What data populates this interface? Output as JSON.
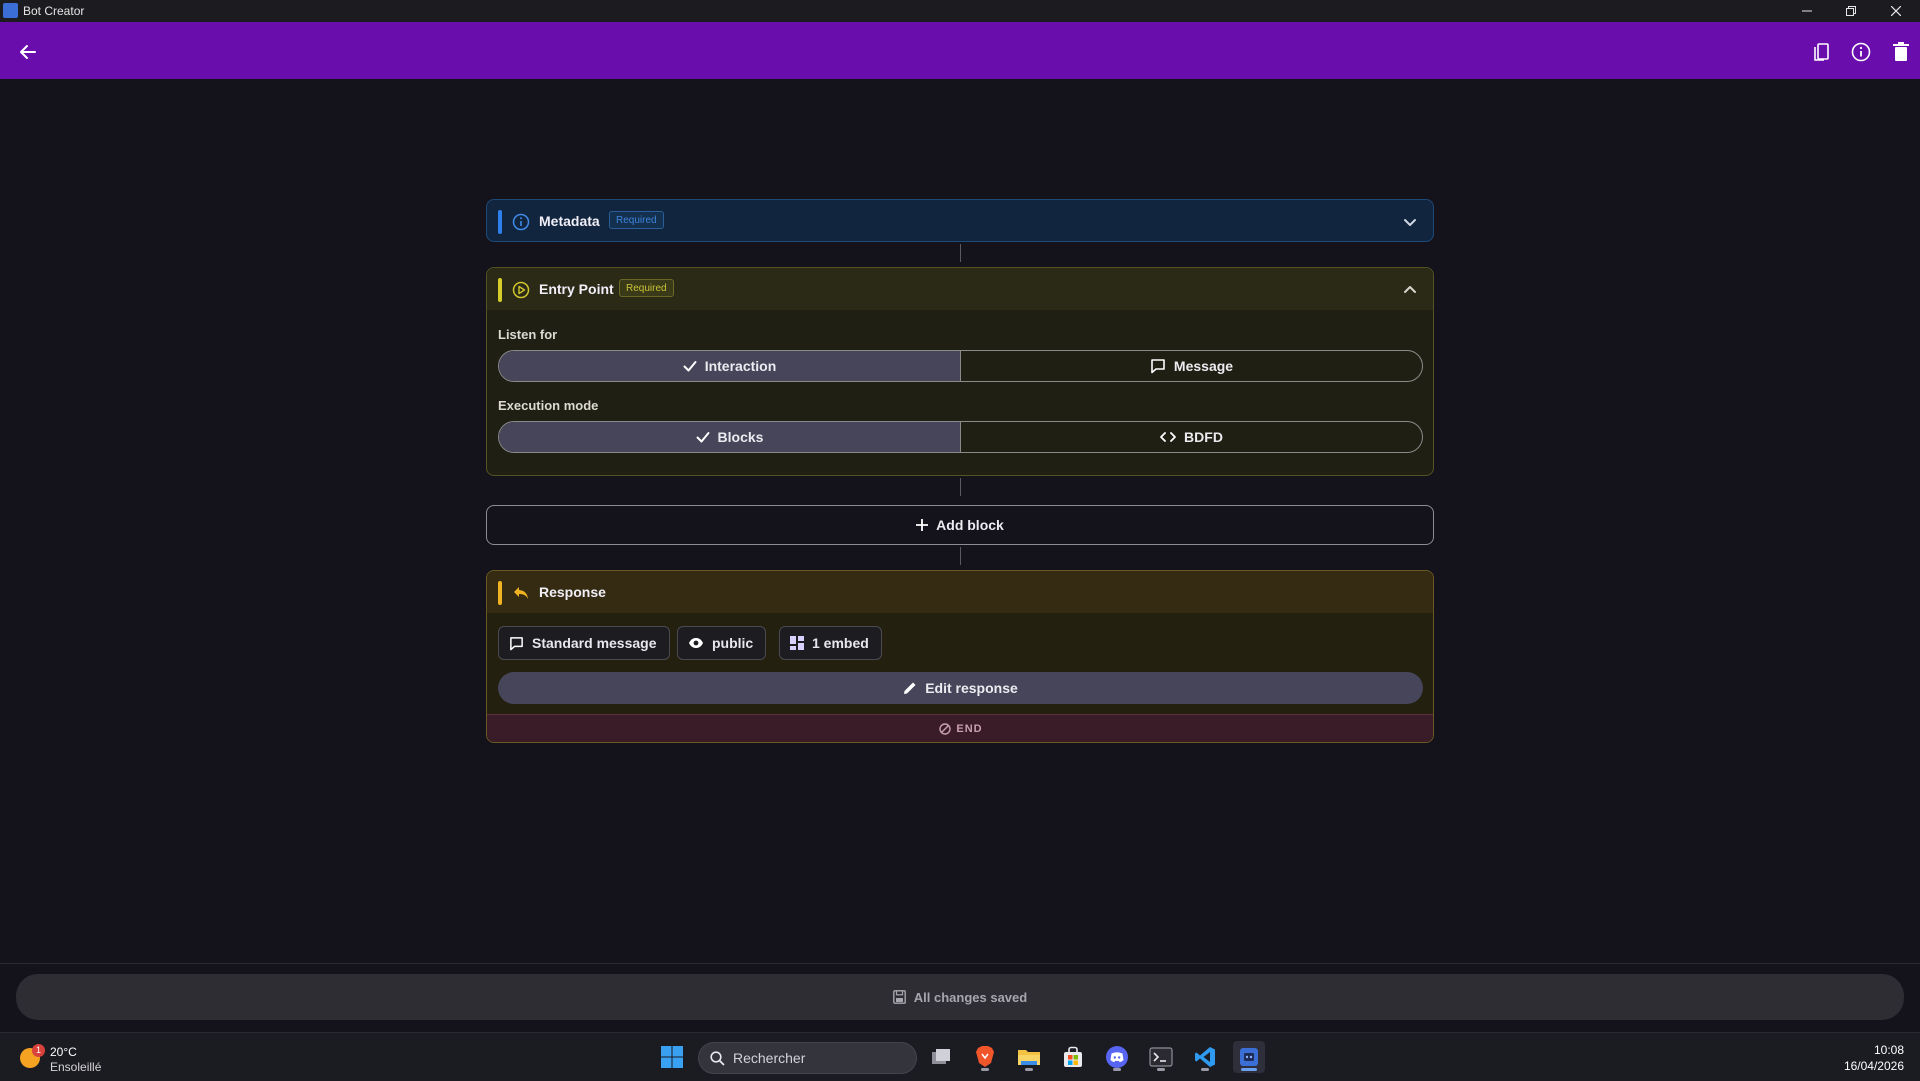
{
  "window": {
    "title": "Bot Creator"
  },
  "metadata": {
    "title": "Metadata",
    "badge": "Required"
  },
  "entry_point": {
    "title": "Entry Point",
    "badge": "Required",
    "listen_for": {
      "label": "Listen for",
      "options": [
        "Interaction",
        "Message"
      ],
      "selected": "Interaction"
    },
    "execution_mode": {
      "label": "Execution mode",
      "options": [
        "Blocks",
        "BDFD"
      ],
      "selected": "Blocks"
    }
  },
  "add_block": {
    "label": "Add block"
  },
  "response": {
    "title": "Response",
    "chips": [
      "Standard message",
      "public",
      "1 embed"
    ],
    "edit_label": "Edit response",
    "end_label": "END"
  },
  "status": {
    "text": "All changes saved"
  },
  "taskbar": {
    "weather": {
      "temp": "20°C",
      "condition": "Ensoleillé",
      "notification_count": "1"
    },
    "search_placeholder": "Rechercher",
    "time": "10:08",
    "date": "16/04/2026"
  },
  "colors": {
    "app_bar": "#6a0dad",
    "metadata_accent": "#2f80ed",
    "entry_accent": "#d4cd2a",
    "response_accent": "#f0b323",
    "background": "#14121a"
  }
}
